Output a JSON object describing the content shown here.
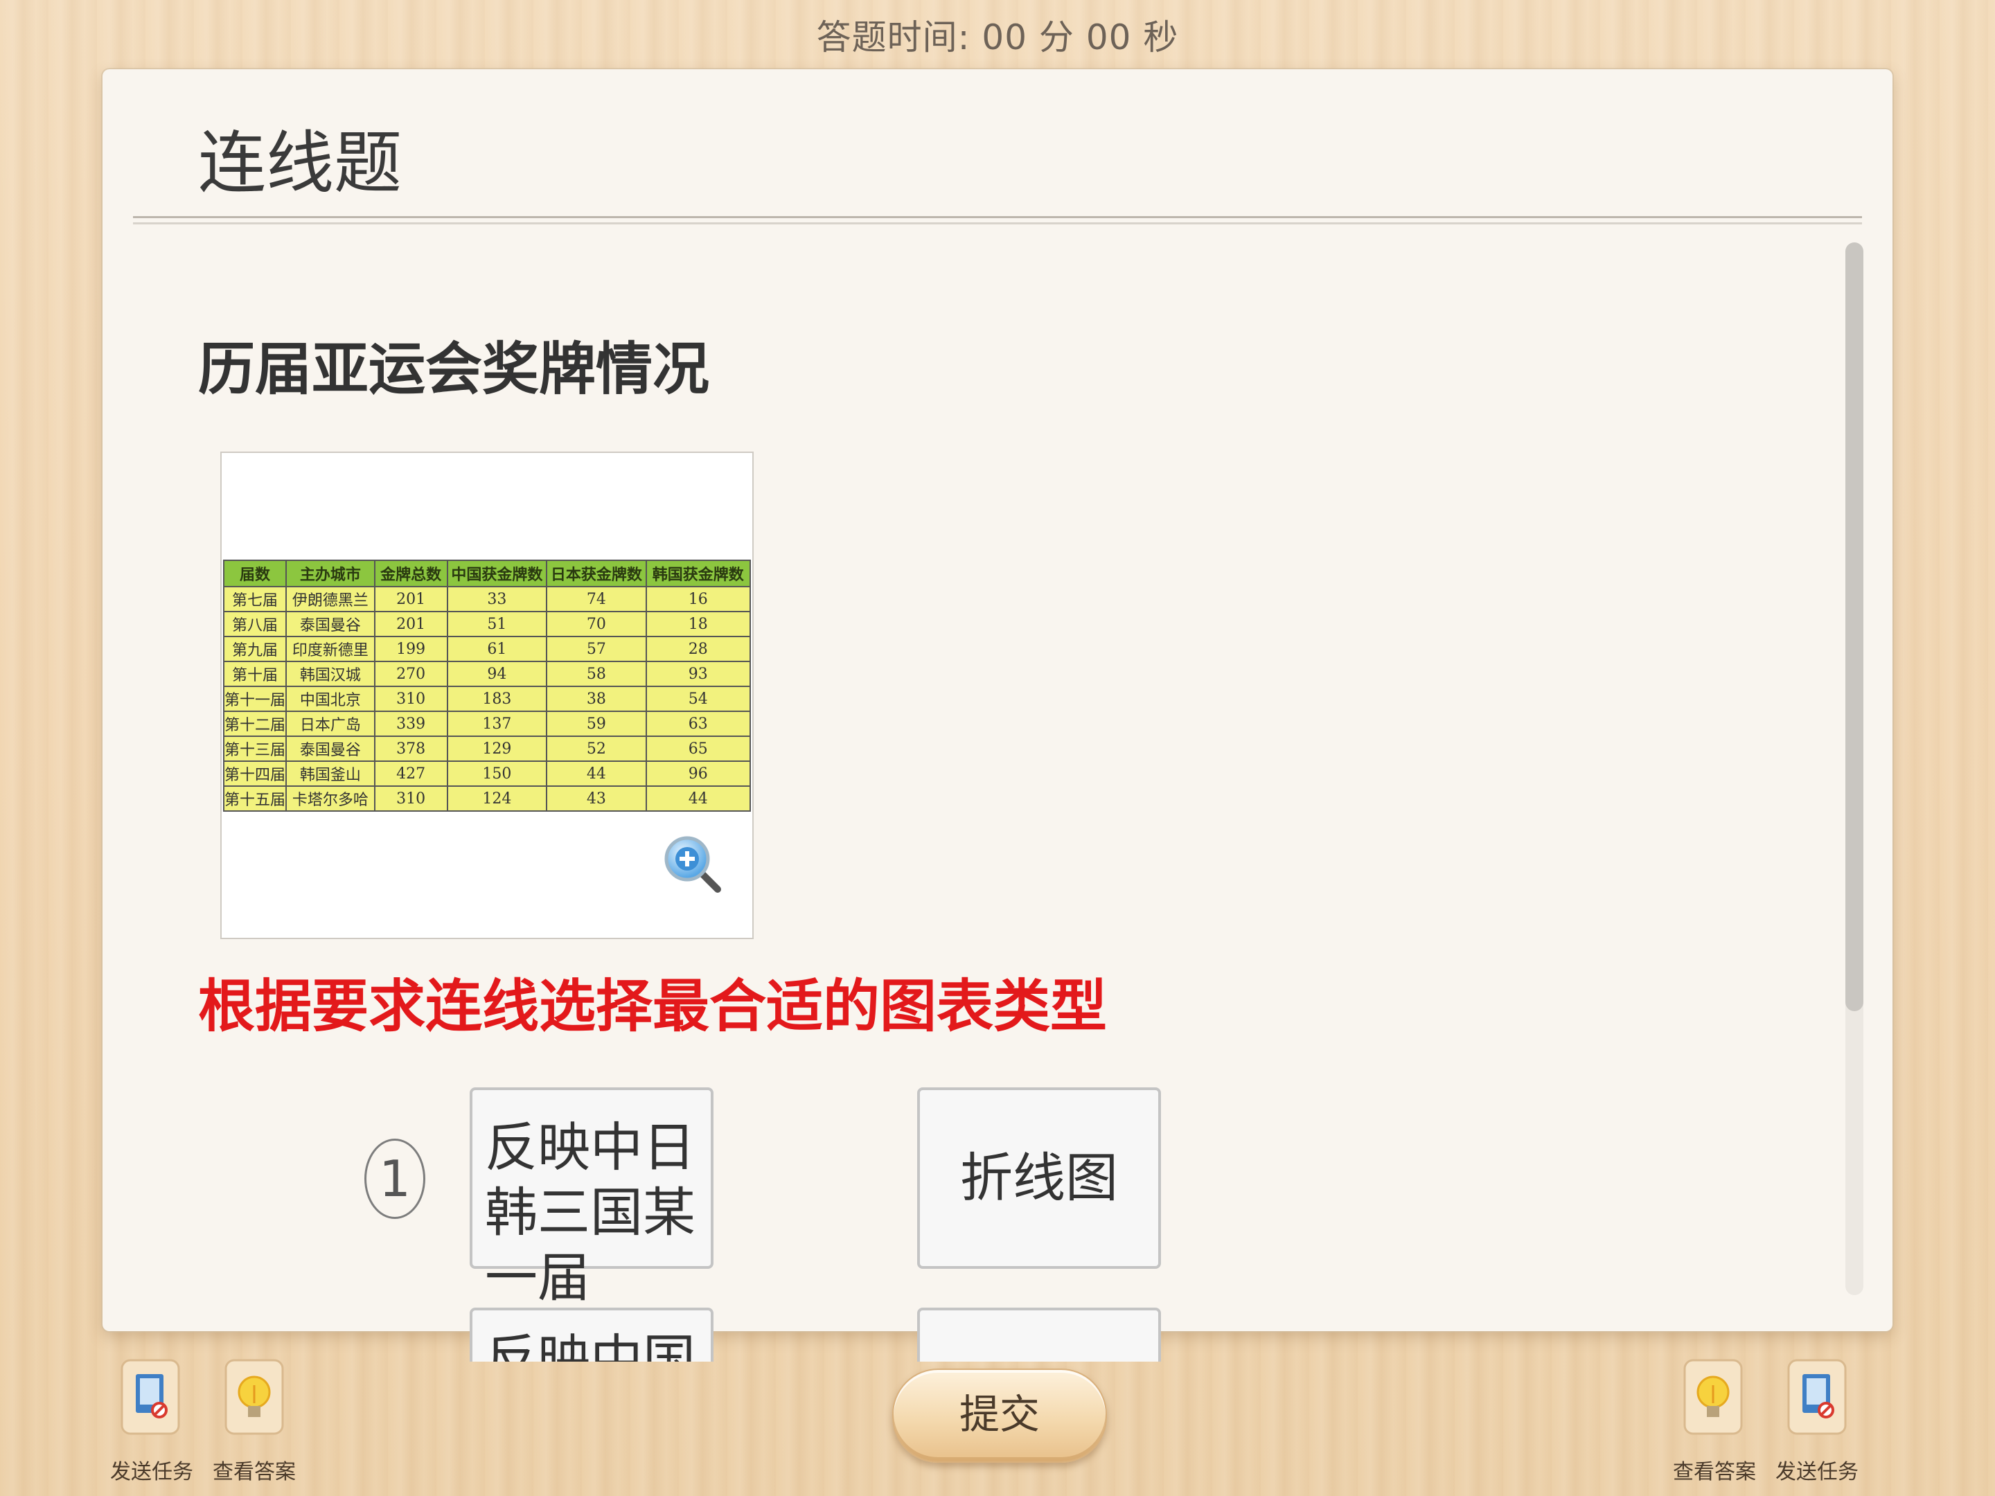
{
  "timer": {
    "label": "答题时间:",
    "value": "00 分 00 秒"
  },
  "card": {
    "type_title": "连线题",
    "question_title": "历届亚运会奖牌情况",
    "instruction": "根据要求连线选择最合适的图表类型"
  },
  "medal_table": {
    "headers": [
      "届数",
      "主办城市",
      "金牌总数",
      "中国获金牌数",
      "日本获金牌数",
      "韩国获金牌数"
    ],
    "rows": [
      [
        "第七届",
        "伊朗德黑兰",
        "201",
        "33",
        "74",
        "16"
      ],
      [
        "第八届",
        "泰国曼谷",
        "201",
        "51",
        "70",
        "18"
      ],
      [
        "第九届",
        "印度新德里",
        "199",
        "61",
        "57",
        "28"
      ],
      [
        "第十届",
        "韩国汉城",
        "270",
        "94",
        "58",
        "93"
      ],
      [
        "第十一届",
        "中国北京",
        "310",
        "183",
        "38",
        "54"
      ],
      [
        "第十二届",
        "日本广岛",
        "339",
        "137",
        "59",
        "63"
      ],
      [
        "第十三届",
        "泰国曼谷",
        "378",
        "129",
        "52",
        "65"
      ],
      [
        "第十四届",
        "韩国釜山",
        "427",
        "150",
        "44",
        "96"
      ],
      [
        "第十五届",
        "卡塔尔多哈",
        "310",
        "124",
        "43",
        "44"
      ]
    ]
  },
  "match": {
    "items": [
      {
        "number": "1",
        "left": "反映中日韩三国某一届",
        "right": "折线图"
      },
      {
        "number": "",
        "left": "反映中国某",
        "right": ""
      }
    ]
  },
  "toolbar": {
    "left": [
      {
        "icon": "send-task-icon",
        "label": "发送任务"
      },
      {
        "icon": "lightbulb-icon",
        "label": "查看答案"
      }
    ],
    "submit_label": "提交",
    "right": [
      {
        "icon": "lightbulb-icon",
        "label": "查看答案"
      },
      {
        "icon": "send-task-icon",
        "label": "发送任务"
      }
    ]
  }
}
